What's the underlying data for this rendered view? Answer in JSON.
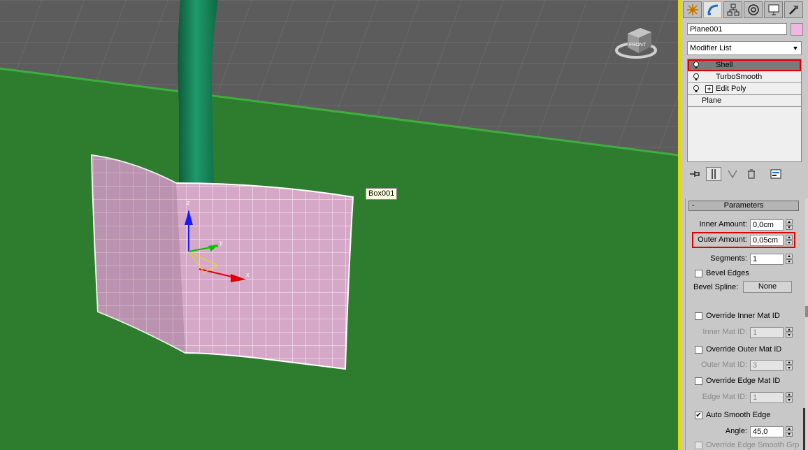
{
  "viewport": {
    "object_label": "Box001",
    "viewcube_face": "FRONT",
    "gizmo_axes": {
      "z": "z",
      "y": "y",
      "x": "x"
    }
  },
  "panel": {
    "tabs": [
      {
        "icon": "create-icon",
        "active": false
      },
      {
        "icon": "modify-icon",
        "active": true
      },
      {
        "icon": "hierarchy-icon",
        "active": false
      },
      {
        "icon": "motion-icon",
        "active": false
      },
      {
        "icon": "display-icon",
        "active": false
      },
      {
        "icon": "utilities-icon",
        "active": false
      }
    ],
    "object_name": "Plane001",
    "object_color": "#f2b6e2",
    "modifier_list_label": "Modifier List",
    "stack": [
      {
        "label": "Shell",
        "bulb": true,
        "expandable": false,
        "selected": true
      },
      {
        "label": "TurboSmooth",
        "bulb": true,
        "expandable": false,
        "selected": false
      },
      {
        "label": "Edit Poly",
        "bulb": true,
        "expandable": true,
        "selected": false
      },
      {
        "label": "Plane",
        "bulb": false,
        "expandable": false,
        "selected": false
      }
    ],
    "parameters": {
      "header": "Parameters",
      "collapse_symbol": "-",
      "inner_amount": {
        "label": "Inner Amount:",
        "value": "0,0cm"
      },
      "outer_amount": {
        "label": "Outer Amount:",
        "value": "0,05cm"
      },
      "segments": {
        "label": "Segments:",
        "value": "1"
      },
      "bevel_edges": {
        "label": "Bevel Edges",
        "checked": false
      },
      "bevel_spline": {
        "label": "Bevel Spline:",
        "button": "None"
      },
      "override_inner_mat": {
        "label": "Override Inner Mat ID",
        "checked": false
      },
      "inner_mat_id": {
        "label": "Inner Mat ID:",
        "value": "1"
      },
      "override_outer_mat": {
        "label": "Override Outer Mat ID",
        "checked": false
      },
      "outer_mat_id": {
        "label": "Outer Mat ID:",
        "value": "3"
      },
      "override_edge_mat": {
        "label": "Override Edge Mat ID",
        "checked": false
      },
      "edge_mat_id": {
        "label": "Edge Mat ID:",
        "value": "1"
      },
      "auto_smooth_edge": {
        "label": "Auto Smooth Edge",
        "checked": true,
        "mark": "✔"
      },
      "angle": {
        "label": "Angle:",
        "value": "45,0"
      },
      "override_edge_smooth": {
        "label": "Override Edge Smooth Grp",
        "checked": false
      }
    },
    "colors": {
      "highlight": "#e00000",
      "active_tab": "#f0a000",
      "separator": "#e6d800"
    }
  }
}
